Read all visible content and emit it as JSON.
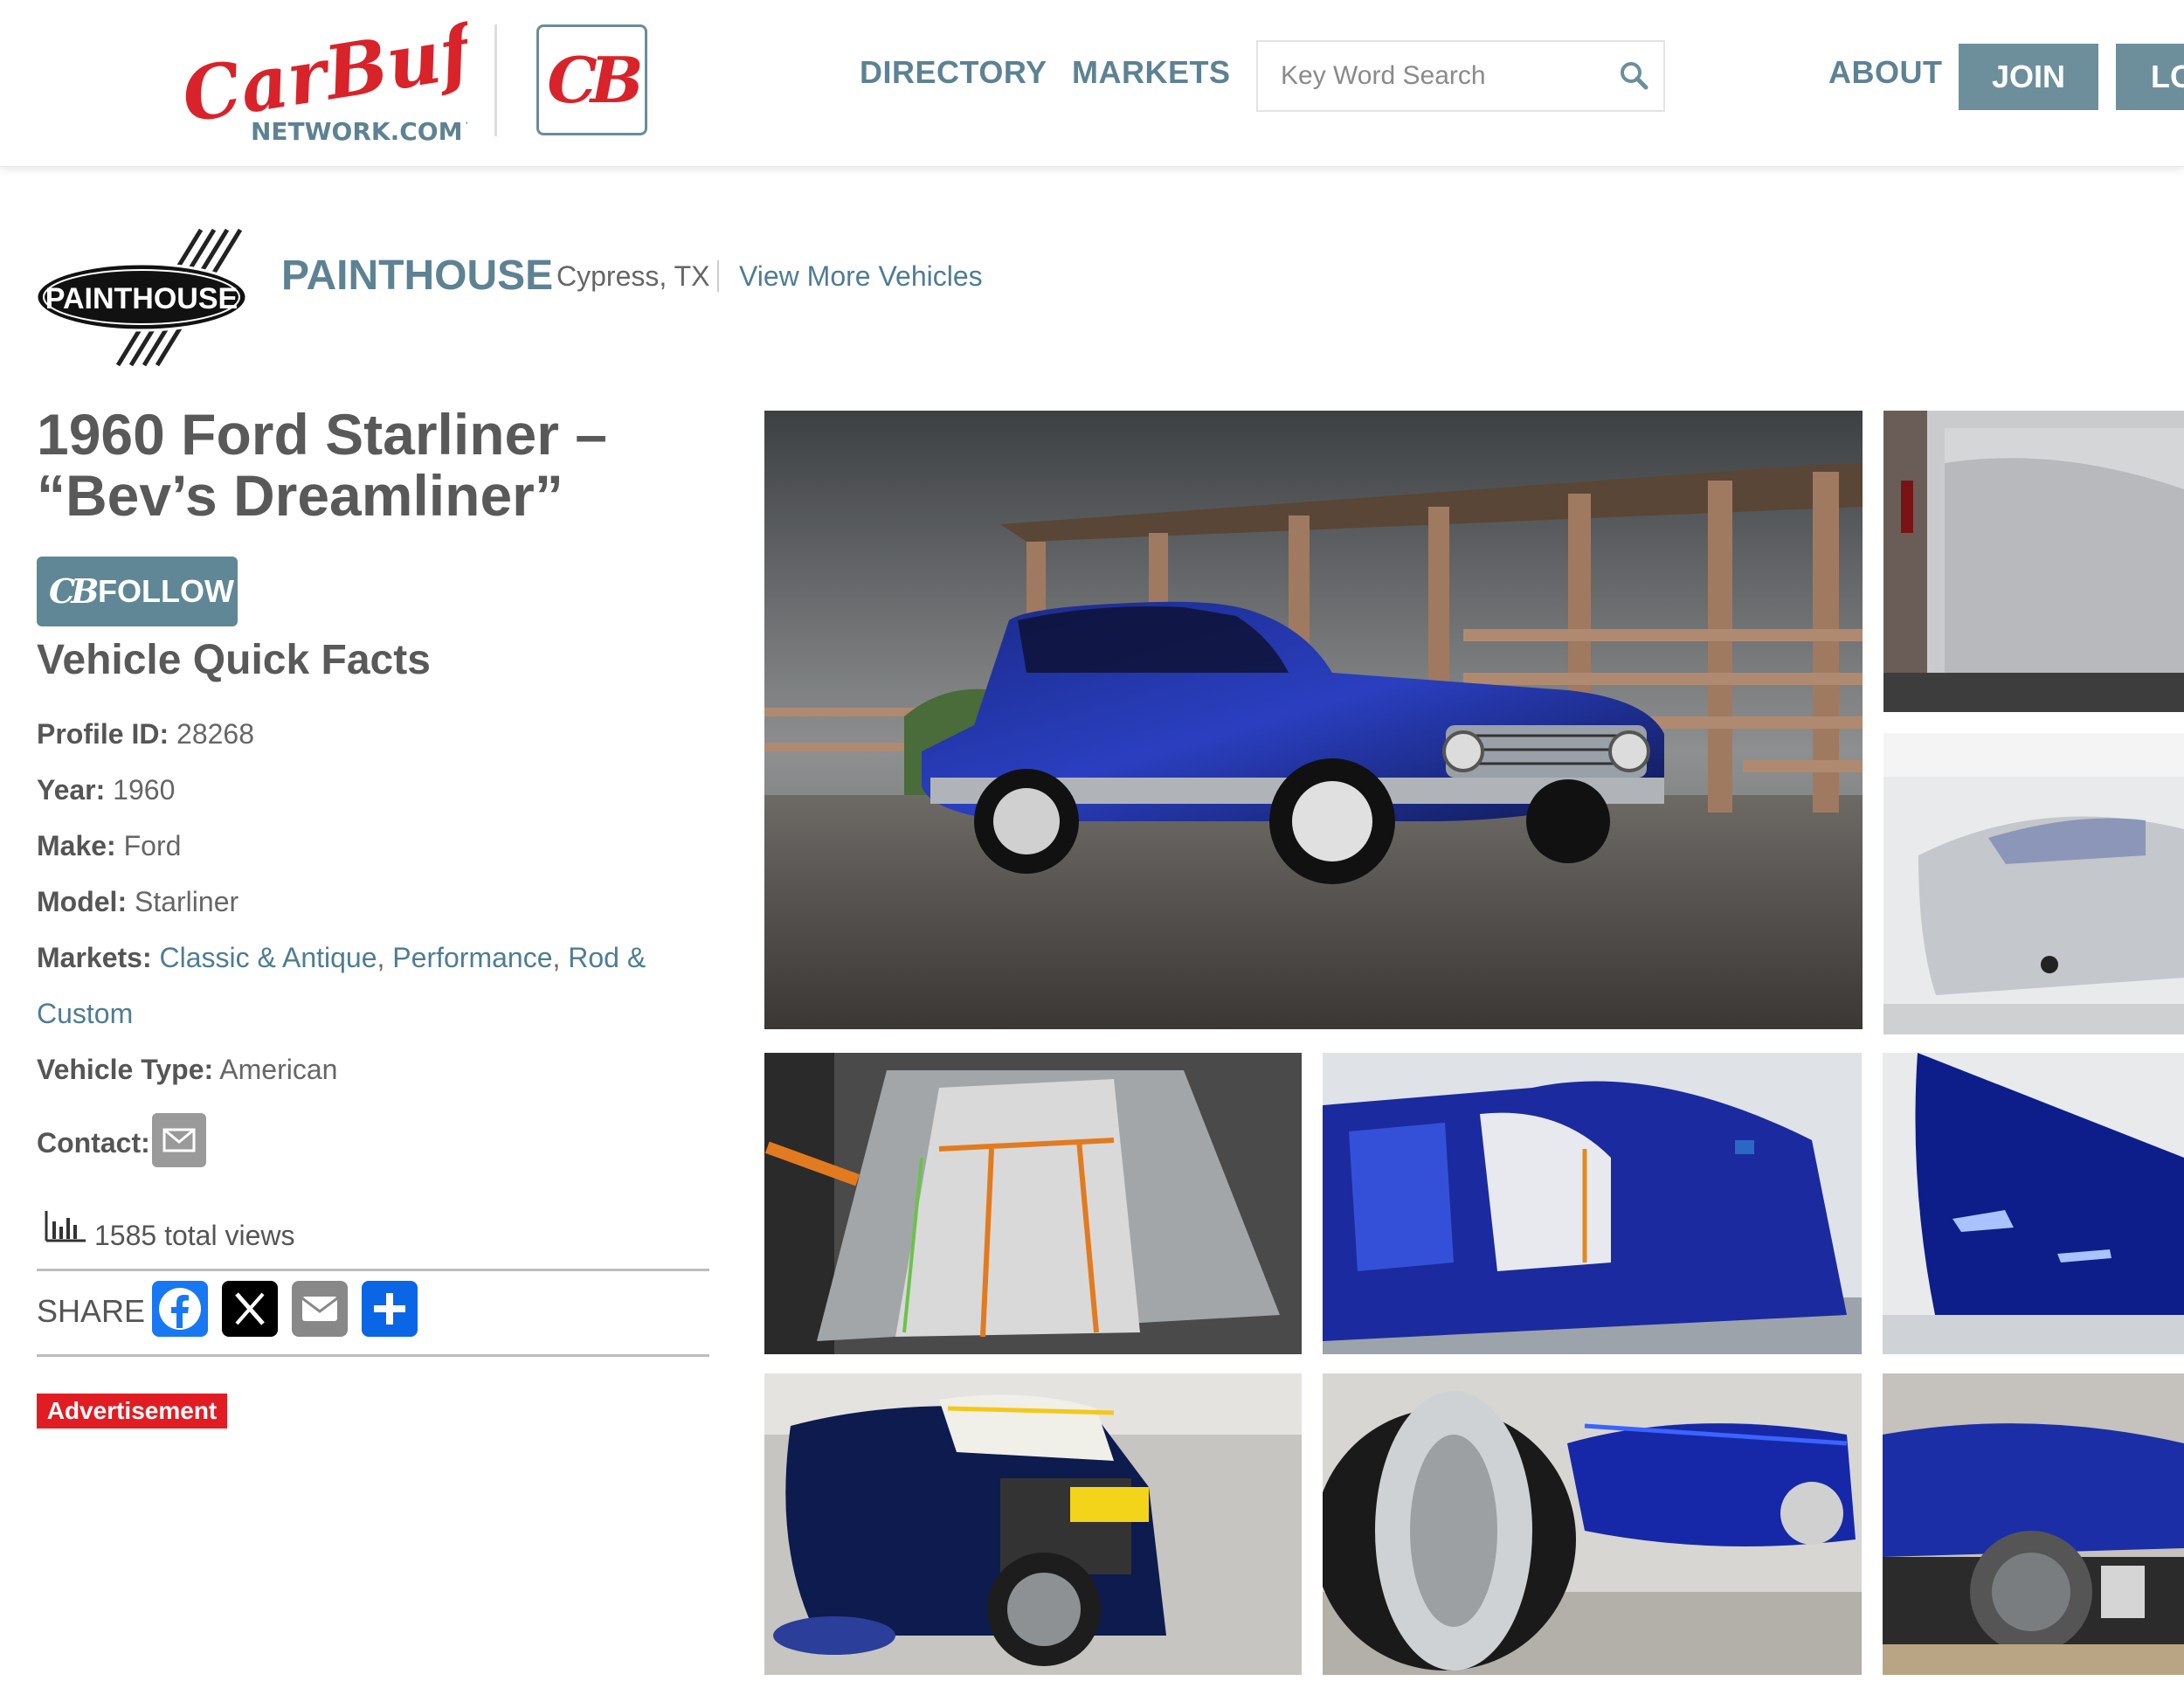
{
  "header": {
    "logo_text": "CarBuff",
    "logo_sub": "NETWORK.COM™",
    "cb_logo": "CB",
    "nav": [
      "DIRECTORY",
      "MARKETS"
    ],
    "search_placeholder": "Key Word Search",
    "about": "ABOUT",
    "join": "JOIN",
    "login": "LOGIN"
  },
  "shop": {
    "logo_text": "PAINTHOUSE",
    "name": "PAINTHOUSE",
    "location": "Cypress, TX",
    "more_link": "View More Vehicles"
  },
  "vehicle": {
    "title": "1960 Ford Starliner – “Bev’s Dreamliner”",
    "follow": "FOLLOW",
    "quick_facts_title": "Vehicle Quick Facts",
    "facts": {
      "profile_id_label": "Profile ID:",
      "profile_id": "28268",
      "year_label": "Year:",
      "year": "1960",
      "make_label": "Make:",
      "make": "Ford",
      "model_label": "Model:",
      "model": "Starliner",
      "markets_label": "Markets:",
      "markets": [
        "Classic & Antique",
        "Performance",
        "Rod &",
        "Custom"
      ],
      "type_label": "Vehicle Type:",
      "type": "American",
      "contact_label": "Contact:"
    },
    "views": "1585 total views",
    "share_label": "SHARE",
    "share_buttons": [
      "facebook-icon",
      "x-icon",
      "email-icon",
      "share-plus-icon"
    ],
    "ad_label": "Advertisement"
  },
  "colors": {
    "accent": "#5d8293",
    "brand_red": "#d8232a",
    "button": "#6d8f9c",
    "facebook": "#1877f2",
    "advert": "#e21c23"
  }
}
